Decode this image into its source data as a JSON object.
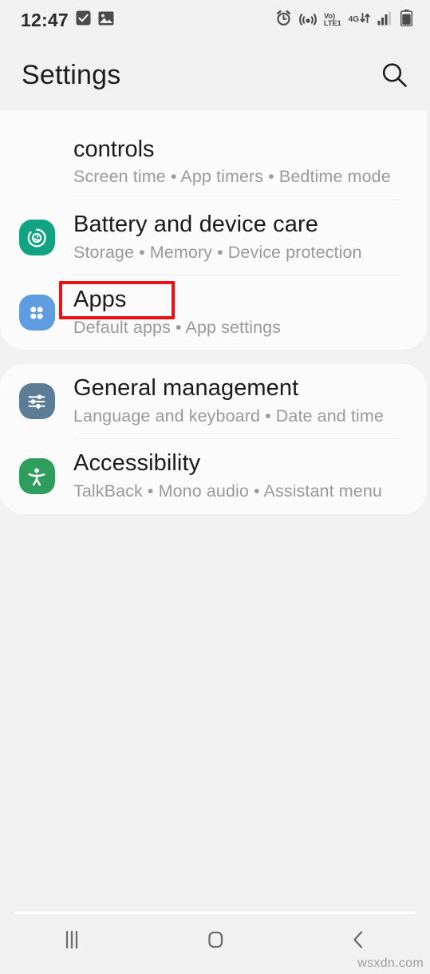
{
  "status_bar": {
    "clock": "12:47",
    "left_icons": [
      "checkbox-checked-icon",
      "image-gallery-icon"
    ],
    "right_icons": [
      "alarm-icon",
      "hotspot-icon",
      "volte-icon",
      "mobile-data-icon",
      "signal-bars-icon",
      "battery-icon"
    ],
    "volte_top": "Vo)",
    "volte_bottom": "LTE1",
    "network_type": "4G",
    "data_arrows": "↓↑"
  },
  "header": {
    "title": "Settings",
    "search_icon": "search-icon"
  },
  "cards": [
    {
      "id": "card-wellbeing",
      "items": [
        {
          "id": "digital-wellbeing",
          "title": "controls",
          "subtitle": "Screen time • App timers • Bedtime mode",
          "icon": "",
          "icon_color": "",
          "clipped": true
        },
        {
          "id": "battery-and-device-care",
          "title": "Battery and device care",
          "subtitle": "Storage • Memory • Device protection",
          "icon": "device-care-icon",
          "icon_color": "#12a383",
          "clipped": false
        },
        {
          "id": "apps",
          "title": "Apps",
          "subtitle": "Default apps • App settings",
          "icon": "apps-grid-icon",
          "icon_color": "#5d9de0",
          "clipped": false,
          "highlighted": true
        }
      ]
    },
    {
      "id": "card-system",
      "items": [
        {
          "id": "general-management",
          "title": "General management",
          "subtitle": "Language and keyboard • Date and time",
          "icon": "sliders-icon",
          "icon_color": "#5d7d96",
          "clipped": false
        },
        {
          "id": "accessibility",
          "title": "Accessibility",
          "subtitle": "TalkBack • Mono audio • Assistant menu",
          "icon": "accessibility-person-icon",
          "icon_color": "#2f9e5d",
          "clipped": false
        }
      ]
    }
  ],
  "annotation": {
    "target": "Apps",
    "color": "#ee1111"
  },
  "nav_bar": {
    "recents_icon": "recents-icon",
    "home_icon": "home-icon",
    "back_icon": "back-icon"
  },
  "watermark": "wsxdn.com",
  "colors": {
    "background": "#f1f1f1",
    "card": "#fbfbfb",
    "title_text": "#1b1b1b",
    "subtitle_text": "#9a9a9a",
    "accent_red": "#ee1111"
  }
}
